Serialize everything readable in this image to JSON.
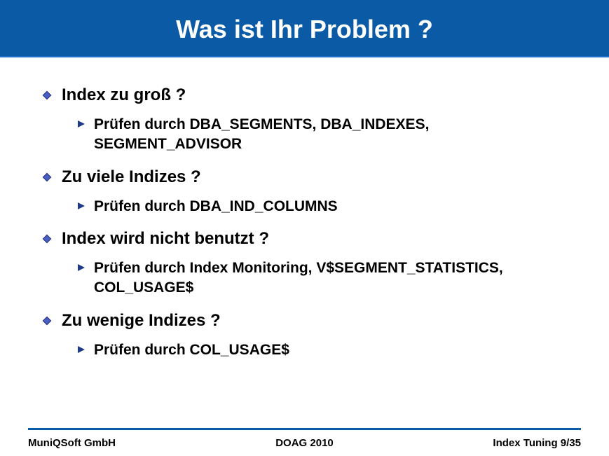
{
  "title": "Was ist Ihr Problem ?",
  "bullets": [
    {
      "text": "Index zu groß ?",
      "sub": [
        "Prüfen durch DBA_SEGMENTS, DBA_INDEXES, SEGMENT_ADVISOR"
      ]
    },
    {
      "text": "Zu viele Indizes ?",
      "sub": [
        "Prüfen durch DBA_IND_COLUMNS"
      ]
    },
    {
      "text": "Index wird nicht benutzt ?",
      "sub": [
        "Prüfen durch Index Monitoring, V$SEGMENT_STATISTICS, COL_USAGE$"
      ]
    },
    {
      "text": "Zu wenige Indizes ?",
      "sub": [
        "Prüfen durch COL_USAGE$"
      ]
    }
  ],
  "footer": {
    "left": "MuniQSoft GmbH",
    "center": "DOAG 2010",
    "right": "Index Tuning  9/35"
  },
  "colors": {
    "title_bg": "#0b5aa6",
    "accent": "#1e4fa0"
  }
}
